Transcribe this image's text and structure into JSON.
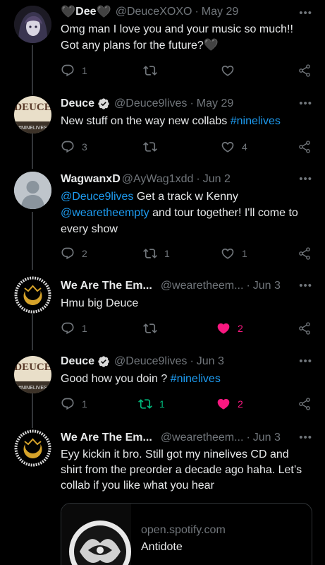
{
  "tweets": [
    {
      "name": "Dee",
      "name_prefix_icon": "black-heart",
      "name_suffix_icon": "black-heart",
      "handle": "@DeuceXOXO",
      "time": "May 29",
      "text": "Omg man I love you and your music so much!! Got any plans for the future?",
      "text_suffix_icon": "black-heart",
      "replies": "1",
      "retweets": "",
      "likes": ""
    },
    {
      "name": "Deuce",
      "verified": true,
      "handle": "@Deuce9lives",
      "time": "May 29",
      "text": "New stuff on the way new collabs ",
      "hashtag": "#ninelives",
      "replies": "3",
      "retweets": "",
      "likes": "4"
    },
    {
      "name": "WagwanxD",
      "handle": "@AyWag1xdd",
      "time": "Jun 2",
      "mention1": "@Deuce9lives",
      "text_part1": " Get a track w Kenny ",
      "mention2": "@wearetheempty",
      "text_part2": " and tour together! I'll come to every show",
      "replies": "2",
      "retweets": "1",
      "likes": "1"
    },
    {
      "name": "We Are The Em...",
      "handle": "@wearetheem...",
      "time": "Jun 3",
      "text": "Hmu big Deuce",
      "replies": "1",
      "retweets": "",
      "likes": "2",
      "liked": true
    },
    {
      "name": "Deuce",
      "verified": true,
      "handle": "@Deuce9lives",
      "time": "Jun 3",
      "text": "Good how you doin ? ",
      "hashtag": "#ninelives",
      "replies": "1",
      "retweets": "1",
      "likes": "2",
      "liked": true,
      "retweeted": true
    },
    {
      "name": "We Are The Em...",
      "handle": "@wearetheem...",
      "time": "Jun 3",
      "text": "Eyy kickin it bro. Still got my ninelives CD and shirt from the preorder a decade ago haha. Let’s collab if you like what you hear"
    }
  ],
  "card": {
    "domain": "open.spotify.com",
    "title": "Antidote"
  },
  "more_label": "•••",
  "separator": "·",
  "heart_glyph": "🖤",
  "colors": {
    "background": "#000000",
    "link": "#1d9bf0",
    "muted": "#71767b",
    "like_active": "#f91880",
    "retweet_active": "#00ba7c"
  }
}
